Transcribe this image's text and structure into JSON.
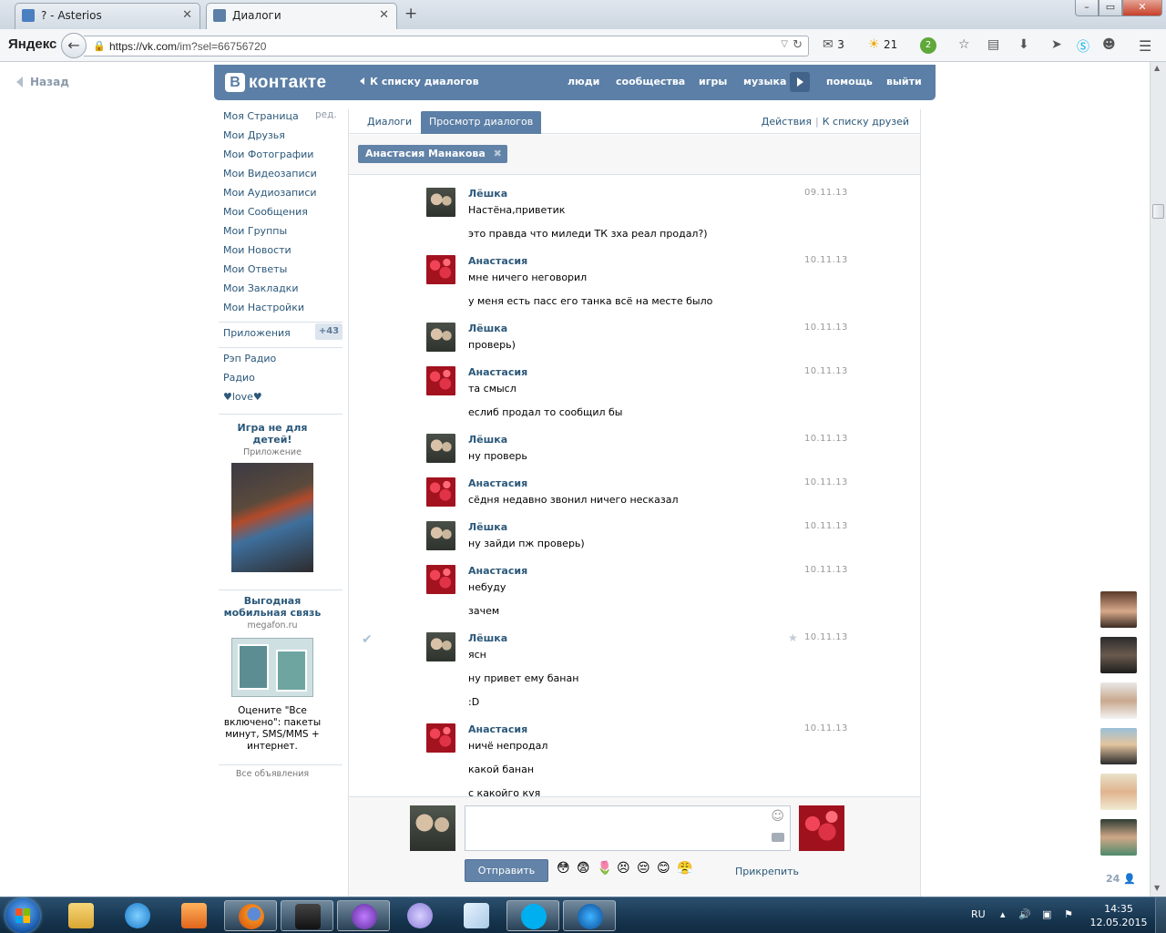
{
  "browser": {
    "tabs": [
      {
        "title": "? - Asterios",
        "active": false
      },
      {
        "title": "Диалоги",
        "active": true
      }
    ],
    "new_tab": "+",
    "yandex_logo": "Яндекс",
    "url_host": "https://vk.com",
    "url_path": "/im?sel=66756720",
    "mail_count": "3",
    "weather": "21",
    "badge_count": "2"
  },
  "page": {
    "back_link": "Назад",
    "vk_logo_letter": "В",
    "vk_logo_text": "контакте",
    "header_back": "К списку диалогов",
    "nav": [
      "люди",
      "сообщества",
      "игры",
      "музыка",
      "помощь",
      "выйти"
    ],
    "menu": [
      "Моя Страница",
      "Мои Друзья",
      "Мои Фотографии",
      "Мои Видеозаписи",
      "Мои Аудиозаписи",
      "Мои Сообщения",
      "Мои Группы",
      "Мои Новости",
      "Мои Ответы",
      "Мои Закладки",
      "Мои Настройки"
    ],
    "edit_label": "ред.",
    "apps_label": "Приложения",
    "apps_count": "+43",
    "extra_menu": [
      "Рэп Радио",
      "Радио",
      "♥love♥"
    ],
    "ad1": {
      "title": "Игра не для детей!",
      "sub": "Приложение"
    },
    "ad2": {
      "title": "Выгодная мобильная связь",
      "sub": "megafon.ru",
      "text": "Оцените \"Все включено\": пакеты минут, SMS/MMS + интернет."
    },
    "all_ads": "Все объявления",
    "tabs": [
      "Диалоги",
      "Просмотр диалогов"
    ],
    "actions": "Действия",
    "to_friends": "К списку друзей",
    "chip": "Анастасия Манакова",
    "messages": [
      {
        "author": "Лёшка",
        "who": "l",
        "date": "09.11.13",
        "lines": [
          "Настёна,приветик",
          "это правда что миледи ТК зха реал продал?)"
        ]
      },
      {
        "author": "Анастасия",
        "who": "a",
        "date": "10.11.13",
        "lines": [
          "мне ничего неговорил",
          "у меня есть пасс его танка всё на месте было"
        ]
      },
      {
        "author": "Лёшка",
        "who": "l",
        "date": "10.11.13",
        "lines": [
          "проверь)"
        ]
      },
      {
        "author": "Анастасия",
        "who": "a",
        "date": "10.11.13",
        "lines": [
          "та смысл",
          "еслиб продал то сообщил бы"
        ]
      },
      {
        "author": "Лёшка",
        "who": "l",
        "date": "10.11.13",
        "lines": [
          "ну проверь"
        ]
      },
      {
        "author": "Анастасия",
        "who": "a",
        "date": "10.11.13",
        "lines": [
          "сёдня недавно звонил ничего несказал"
        ]
      },
      {
        "author": "Лёшка",
        "who": "l",
        "date": "10.11.13",
        "lines": [
          "ну зайди пж проверь)"
        ]
      },
      {
        "author": "Анастасия",
        "who": "a",
        "date": "10.11.13",
        "lines": [
          "небуду",
          "зачем"
        ]
      },
      {
        "author": "Лёшка",
        "who": "l",
        "date": "10.11.13",
        "lines": [
          "ясн",
          "ну привет ему банан",
          ":D"
        ]
      },
      {
        "author": "Анастасия",
        "who": "a",
        "date": "10.11.13",
        "lines": [
          "ничё непродал",
          "какой банан",
          "с какойго куя"
        ]
      }
    ],
    "send_label": "Отправить",
    "attach_label": "Прикрепить",
    "emoji": [
      "😳",
      "😨",
      "🌷",
      "😣",
      "😔",
      "😊",
      "😤"
    ],
    "friends_count": "24"
  },
  "taskbar": {
    "lang": "RU",
    "time": "14:35",
    "date": "12.05.2015"
  }
}
